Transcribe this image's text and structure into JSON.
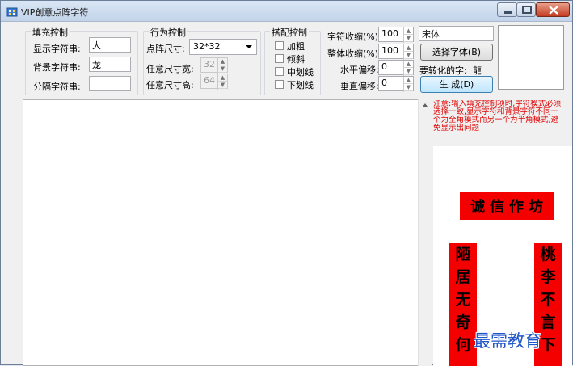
{
  "window": {
    "title": "VIP创意点阵字符"
  },
  "fill_group": {
    "title": "填充控制",
    "display_label": "显示字符串:",
    "display_value": "大",
    "background_label": "背景字符串:",
    "background_value": "龙",
    "separator_label": "分隔字符串:",
    "separator_value": ""
  },
  "behavior_group": {
    "title": "行为控制",
    "matrix_label": "点阵尺寸:",
    "matrix_value": "32*32",
    "width_label": "任意尺寸宽:",
    "width_value": "32",
    "height_label": "任意尺寸高:",
    "height_value": "64"
  },
  "style_group": {
    "title": "搭配控制",
    "bold": "加粗",
    "italic": "倾斜",
    "strike": "中划线",
    "underline": "下划线"
  },
  "options": {
    "char_scale_label": "字符收缩(%):",
    "char_scale_value": "100",
    "overall_scale_label": "整体收缩(%):",
    "overall_scale_value": "100",
    "h_offset_label": "水平偏移:",
    "h_offset_value": "0",
    "v_offset_label": "垂直偏移:",
    "v_offset_value": "0",
    "font_name": "宋体",
    "choose_font_button": "选择字体(B)",
    "convert_label": "要转化的字:",
    "convert_value": "龍",
    "generate_button": "生 成(D)"
  },
  "notice": "注意:输入填充控制项时,字符模式必须选择一致,显示字符和背景字符不同一个为全角模式而另一个为半角模式,避免显示出问题",
  "preview": {
    "banner": [
      "诚",
      "信",
      "作",
      "坊"
    ],
    "left_column": [
      "陋",
      "居",
      "无",
      "奇",
      "何"
    ],
    "right_column": [
      "桃",
      "李",
      "不",
      "言",
      "下"
    ]
  },
  "watermark": "最需教育"
}
